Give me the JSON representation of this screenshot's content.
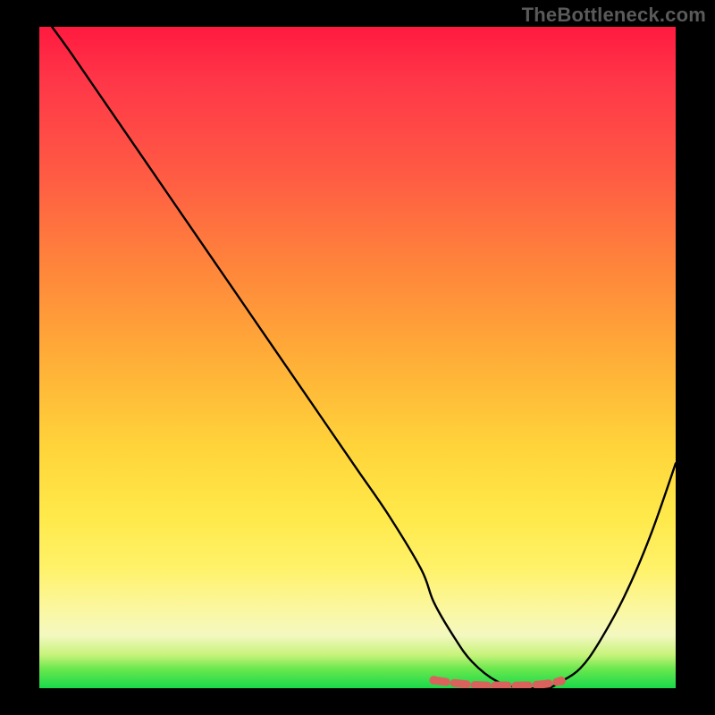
{
  "watermark": "TheBottleneck.com",
  "colors": {
    "background": "#000000",
    "curve": "#000000",
    "marker": "#d9635c",
    "gradient_top": "#ff1a3f",
    "gradient_bottom": "#19d94a"
  },
  "chart_data": {
    "type": "line",
    "title": "",
    "xlabel": "",
    "ylabel": "",
    "xlim": [
      0,
      100
    ],
    "ylim": [
      0,
      100
    ],
    "series": [
      {
        "name": "bottleneck-curve",
        "x": [
          2,
          5,
          10,
          15,
          20,
          25,
          30,
          35,
          40,
          45,
          50,
          55,
          60,
          62,
          65,
          68,
          72,
          76,
          78,
          80,
          82,
          85,
          88,
          92,
          96,
          100
        ],
        "y": [
          100,
          96,
          89,
          82,
          75,
          68,
          61,
          54,
          47,
          40,
          33,
          26,
          18,
          13,
          8,
          4,
          1,
          0,
          0,
          0,
          1,
          3,
          7,
          14,
          23,
          34
        ]
      }
    ],
    "annotations": [
      {
        "name": "optimal-range",
        "style": "thick-dashed-highlight",
        "x": [
          62,
          65,
          68,
          70,
          72,
          74,
          76,
          78,
          80,
          82
        ],
        "y": [
          1.2,
          0.8,
          0.5,
          0.4,
          0.4,
          0.4,
          0.4,
          0.5,
          0.7,
          1.1
        ]
      }
    ]
  }
}
